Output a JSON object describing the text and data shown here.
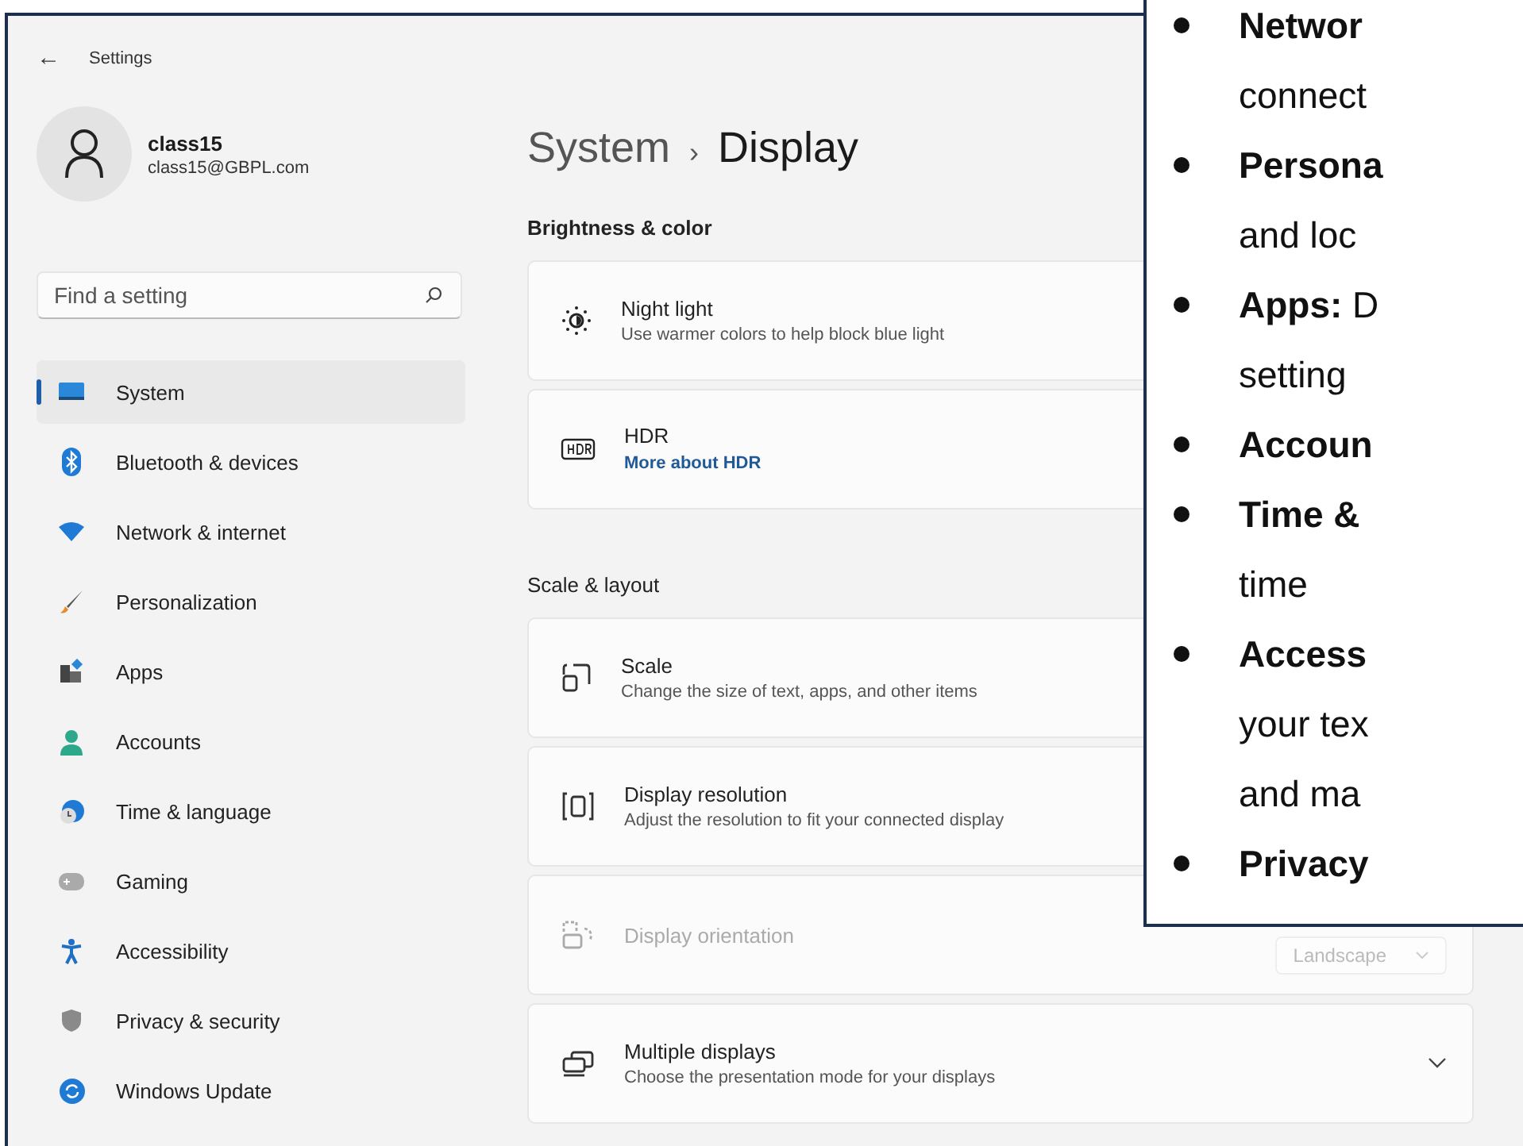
{
  "window": {
    "back": "←",
    "title": "Settings"
  },
  "account": {
    "name": "class15",
    "email": "class15@GBPL.com"
  },
  "search": {
    "placeholder": "Find a setting"
  },
  "sidebar": {
    "items": [
      {
        "label": "System",
        "selected": true
      },
      {
        "label": "Bluetooth & devices",
        "selected": false
      },
      {
        "label": "Network & internet",
        "selected": false
      },
      {
        "label": "Personalization",
        "selected": false
      },
      {
        "label": "Apps",
        "selected": false
      },
      {
        "label": "Accounts",
        "selected": false
      },
      {
        "label": "Time & language",
        "selected": false
      },
      {
        "label": "Gaming",
        "selected": false
      },
      {
        "label": "Accessibility",
        "selected": false
      },
      {
        "label": "Privacy & security",
        "selected": false
      },
      {
        "label": "Windows Update",
        "selected": false
      }
    ]
  },
  "breadcrumb": {
    "parent": "System",
    "separator": "›",
    "current": "Display"
  },
  "sections": [
    {
      "title": "Brightness & color",
      "cards": [
        {
          "title": "Night light",
          "subtitle": "Use warmer colors to help block blue light",
          "disabled": false
        },
        {
          "title": "HDR",
          "link": "More about HDR",
          "disabled": false
        }
      ]
    },
    {
      "title": "Scale & layout",
      "cards": [
        {
          "title": "Scale",
          "subtitle": "Change the size of text, apps, and other items",
          "disabled": false
        },
        {
          "title": "Display resolution",
          "subtitle": "Adjust the resolution to fit your connected display",
          "disabled": false
        },
        {
          "title": "Display orientation",
          "disabled": true,
          "dropdown": "Landscape"
        },
        {
          "title": "Multiple displays",
          "subtitle": "Choose the presentation mode for your displays",
          "disabled": false,
          "expandable": true
        }
      ]
    }
  ],
  "note": {
    "items": [
      {
        "lines": [
          "**Networ**",
          "connect"
        ]
      },
      {
        "lines": [
          "**Persona**",
          "and loc"
        ]
      },
      {
        "lines": [
          "**Apps:** D",
          "setting"
        ]
      },
      {
        "lines": [
          "**Accoun**"
        ]
      },
      {
        "lines": [
          "**Time &**",
          "time"
        ]
      },
      {
        "lines": [
          "**Access**",
          "your tex",
          "and ma"
        ]
      },
      {
        "lines": [
          "**Privacy**"
        ]
      }
    ]
  }
}
